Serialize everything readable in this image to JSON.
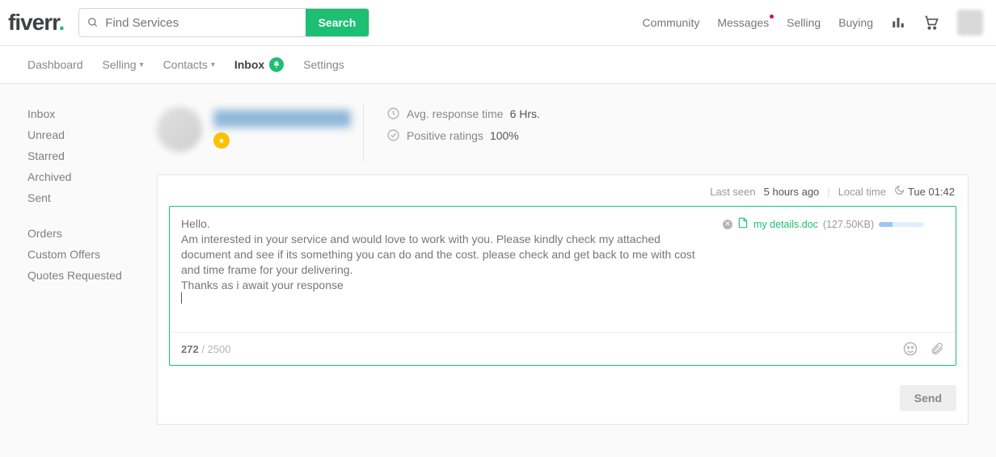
{
  "header": {
    "logo_text": "fiverr",
    "search_placeholder": "Find Services",
    "search_button": "Search",
    "links": {
      "community": "Community",
      "messages": "Messages",
      "selling": "Selling",
      "buying": "Buying"
    }
  },
  "subnav": {
    "dashboard": "Dashboard",
    "selling": "Selling",
    "contacts": "Contacts",
    "inbox": "Inbox",
    "settings": "Settings"
  },
  "sidebar": {
    "group1": {
      "inbox": "Inbox",
      "unread": "Unread",
      "starred": "Starred",
      "archived": "Archived",
      "sent": "Sent"
    },
    "group2": {
      "orders": "Orders",
      "custom_offers": "Custom Offers",
      "quotes_requested": "Quotes Requested"
    }
  },
  "contact": {
    "response_time_label": "Avg. response time",
    "response_time_value": "6 Hrs.",
    "positive_ratings_label": "Positive ratings",
    "positive_ratings_value": "100%"
  },
  "compose_meta": {
    "last_seen_label": "Last seen",
    "last_seen_value": "5 hours ago",
    "local_time_label": "Local time",
    "local_time_value": "Tue 01:42"
  },
  "message": {
    "text": "Hello.\nAm interested in your service and would love to work with you. Please kindly check my attached document and see if its something you can do and the cost. please check and get back to me with cost and time frame for your delivering.\nThanks as i await your response",
    "char_current": "272",
    "char_max": "2500"
  },
  "attachment": {
    "name": "my details.doc",
    "size": "(127.50KB)"
  },
  "actions": {
    "send": "Send"
  }
}
